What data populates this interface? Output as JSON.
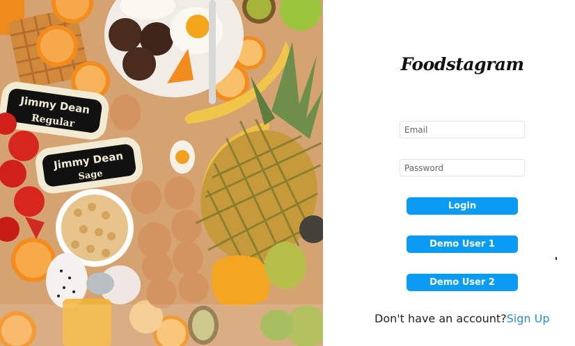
{
  "brand": {
    "title": "Foodstagram"
  },
  "login_form": {
    "email_placeholder": "Email",
    "password_placeholder": "Password",
    "login_label": "Login",
    "demo_user_1_label": "Demo User 1",
    "demo_user_2_label": "Demo User 2"
  },
  "signup_prompt": {
    "text": "Don't have an account?",
    "link_label": "Sign Up"
  },
  "hero_image": {
    "package_1_brand": "Jimmy Dean",
    "package_1_flavor": "Regular",
    "package_2_brand": "Jimmy Dean",
    "package_2_flavor": "Sage"
  },
  "colors": {
    "button": "#0a9bf5",
    "link": "#2a8bd6",
    "text": "#222222"
  }
}
